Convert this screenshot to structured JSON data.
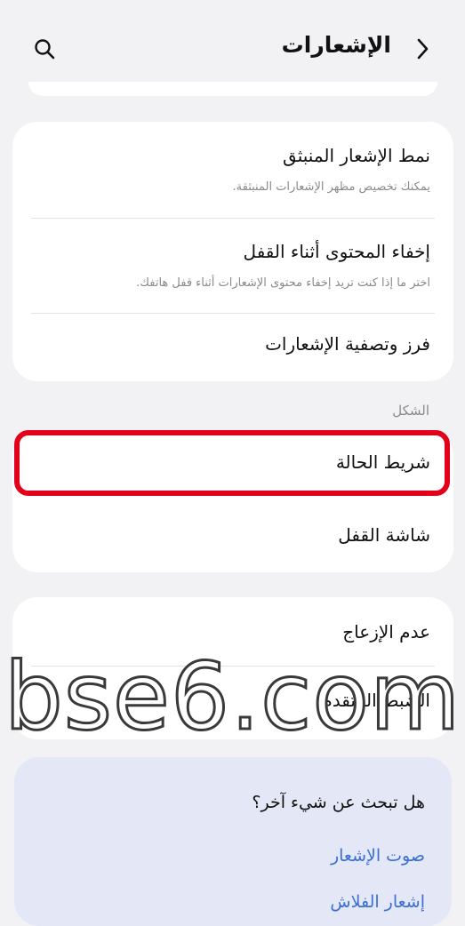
{
  "header": {
    "title": "الإشعارات",
    "back_icon": "chevron-right-icon",
    "search_icon": "search-icon"
  },
  "card1": {
    "items": [
      {
        "label": "نمط الإشعار المنبثق",
        "sub": "يمكنك تخصيص مظهر الإشعارات المنبثقة."
      },
      {
        "label": "إخفاء المحتوى أثناء القفل",
        "sub": "اختر ما إذا كنت تريد إخفاء محتوى الإشعارات أثناء قفل هاتفك."
      },
      {
        "label": "فرز وتصفية الإشعارات"
      }
    ]
  },
  "section_label": "الشكل",
  "card2": {
    "items": [
      {
        "label": "شريط الحالة"
      },
      {
        "label": "شاشة القفل"
      }
    ]
  },
  "card3": {
    "items": [
      {
        "label": "عدم الإزعاج"
      },
      {
        "label": "الضبط المتقدم"
      }
    ]
  },
  "suggestions": {
    "title": "هل تبحث عن شيء آخر؟",
    "links": [
      "صوت الإشعار",
      "إشعار الفلاش"
    ]
  },
  "watermark": "bse6.com",
  "colors": {
    "highlight": "#e2001a",
    "link": "#3b6fd4",
    "background": "#f2f2f4"
  }
}
